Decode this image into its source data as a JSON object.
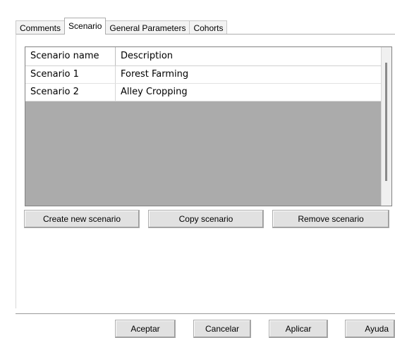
{
  "tabs": [
    {
      "label": "Comments"
    },
    {
      "label": "Scenario"
    },
    {
      "label": "General Parameters"
    },
    {
      "label": "Cohorts"
    }
  ],
  "grid": {
    "columns": [
      "Scenario name",
      "Description"
    ],
    "rows": [
      {
        "name": "Scenario 1",
        "description": "Forest Farming"
      },
      {
        "name": "Scenario 2",
        "description": "Alley Cropping"
      }
    ]
  },
  "scenario_buttons": {
    "create": "Create new scenario",
    "copy": "Copy scenario",
    "remove": "Remove scenario"
  },
  "dialog_buttons": {
    "ok": "Aceptar",
    "cancel": "Cancelar",
    "apply": "Aplicar",
    "help": "Ayuda"
  }
}
